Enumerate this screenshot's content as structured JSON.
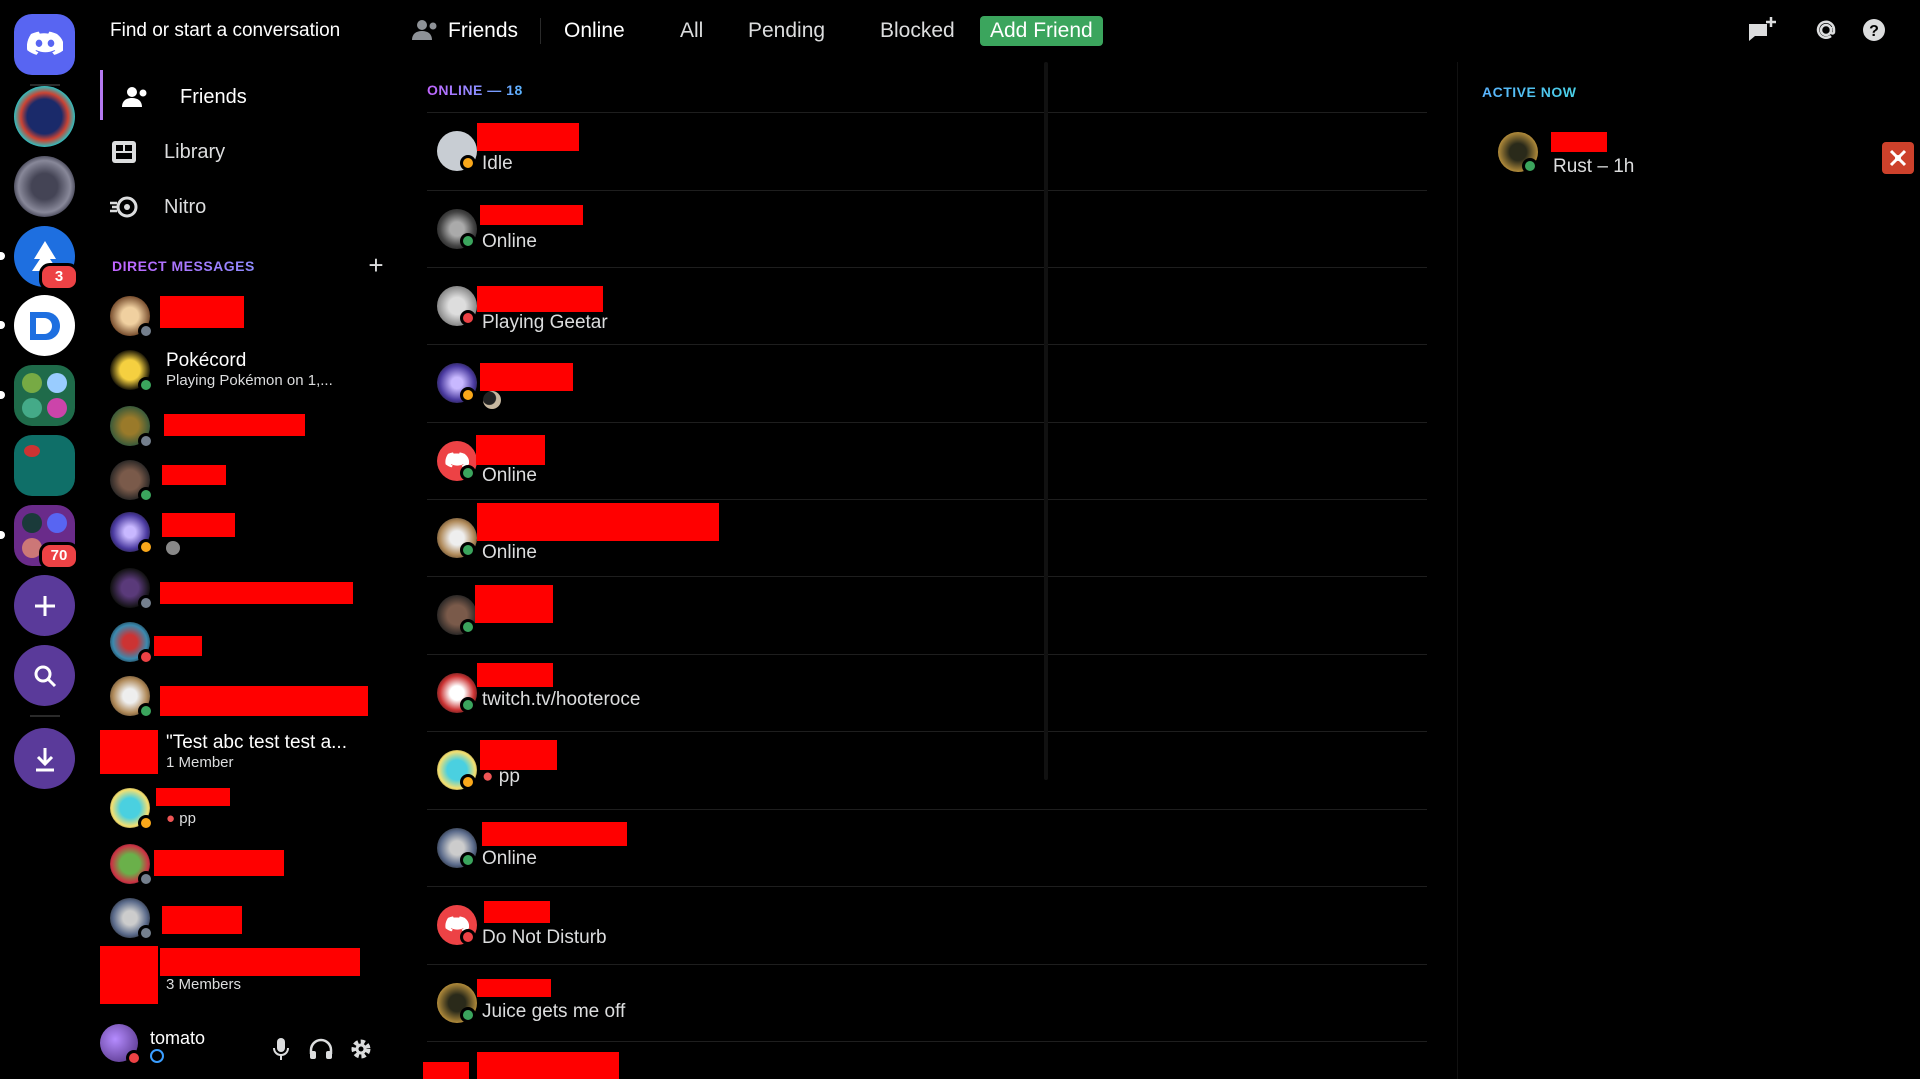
{
  "rail": {
    "badges": {
      "server_4": "3",
      "server_8": "70"
    }
  },
  "sidebar": {
    "search_placeholder": "Find or start a conversation",
    "nav": [
      {
        "label": "Friends",
        "icon": "friends-icon"
      },
      {
        "label": "Library",
        "icon": "library-icon"
      },
      {
        "label": "Nitro",
        "icon": "nitro-icon"
      }
    ],
    "dm_header": "DIRECT MESSAGES",
    "dm_add": "+",
    "dms": [
      {
        "name": "",
        "sub": "",
        "status": "offline"
      },
      {
        "name": "Pokécord",
        "sub": "Playing Pokémon on 1,...",
        "status": "online"
      },
      {
        "name": "",
        "sub": "",
        "status": "offline"
      },
      {
        "name": "",
        "sub": "",
        "status": "online"
      },
      {
        "name": "",
        "sub": "",
        "status": "idle"
      },
      {
        "name": "",
        "sub": "",
        "status": "offline"
      },
      {
        "name": "",
        "sub": "",
        "status": "dnd"
      },
      {
        "name": "",
        "sub": "",
        "status": "online"
      },
      {
        "name": "\"Test abc test test a...",
        "sub": "1 Member",
        "status": "group"
      },
      {
        "name": "",
        "sub": "pp",
        "status": "idle"
      },
      {
        "name": "",
        "sub": "",
        "status": "offline"
      },
      {
        "name": "",
        "sub": "",
        "status": "offline"
      },
      {
        "name": "",
        "sub": "3 Members",
        "status": "group"
      }
    ]
  },
  "user": {
    "name": "tomato"
  },
  "topbar": {
    "title": "Friends",
    "tabs": [
      "Online",
      "All",
      "Pending",
      "Blocked"
    ],
    "add_friend": "Add Friend"
  },
  "friends": {
    "online_header": "ONLINE — 18",
    "rows": [
      {
        "sub": "Idle",
        "status": "idle"
      },
      {
        "sub": "Online",
        "status": "online"
      },
      {
        "sub": "Playing Geetar",
        "status": "dnd"
      },
      {
        "sub": "",
        "status": "idle"
      },
      {
        "sub": "Online",
        "status": "online"
      },
      {
        "sub": "Online",
        "status": "online"
      },
      {
        "sub": "",
        "status": "online"
      },
      {
        "sub": "twitch.tv/hooteroce",
        "status": "online"
      },
      {
        "sub": "pp",
        "status": "idle"
      },
      {
        "sub": "Online",
        "status": "online"
      },
      {
        "sub": "Do Not Disturb",
        "status": "dnd"
      },
      {
        "sub": "Juice gets me off",
        "status": "online"
      },
      {
        "sub": "",
        "status": "online"
      }
    ]
  },
  "active_now": {
    "title": "ACTIVE NOW",
    "activity": "Rust – 1h"
  },
  "colors": {
    "online": "#3ba55d",
    "idle": "#faa81a",
    "dnd": "#ed4245",
    "offline": "#747f8d",
    "accent": "#5865f2",
    "add_friend": "#3ba55d",
    "redaction": "#ff0000"
  }
}
